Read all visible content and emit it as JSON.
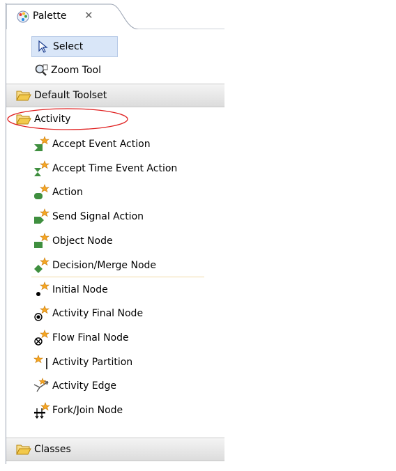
{
  "tab": {
    "title": "Palette",
    "close_icon": "close-icon"
  },
  "tools": [
    {
      "label": "Select",
      "icon": "arrow-cursor-icon",
      "selected": true
    },
    {
      "label": "Zoom Tool",
      "icon": "zoom-icon"
    }
  ],
  "drawers": {
    "default_toolset": "Default Toolset",
    "activity": "Activity",
    "classes": "Classes"
  },
  "activity_items": [
    {
      "label": "Accept Event Action",
      "icon": "accept-event-action-icon"
    },
    {
      "label": "Accept Time Event Action",
      "icon": "accept-time-event-action-icon"
    },
    {
      "label": "Action",
      "icon": "action-icon"
    },
    {
      "label": "Send Signal Action",
      "icon": "send-signal-action-icon"
    },
    {
      "label": "Object Node",
      "icon": "object-node-icon"
    },
    {
      "label": "Decision/Merge Node",
      "icon": "decision-merge-node-icon"
    },
    {
      "label": "Initial Node",
      "icon": "initial-node-icon"
    },
    {
      "label": "Activity Final Node",
      "icon": "activity-final-node-icon"
    },
    {
      "label": "Flow Final Node",
      "icon": "flow-final-node-icon"
    },
    {
      "label": "Activity Partition",
      "icon": "activity-partition-icon"
    },
    {
      "label": "Activity Edge",
      "icon": "activity-edge-icon"
    },
    {
      "label": "Fork/Join Node",
      "icon": "fork-join-node-icon"
    }
  ],
  "colors": {
    "selection": "#d9e6f8",
    "highlight_ring": "#e02020",
    "folder": "#f2c94c",
    "node_green": "#3f8f3f",
    "star": "#f5a623"
  }
}
